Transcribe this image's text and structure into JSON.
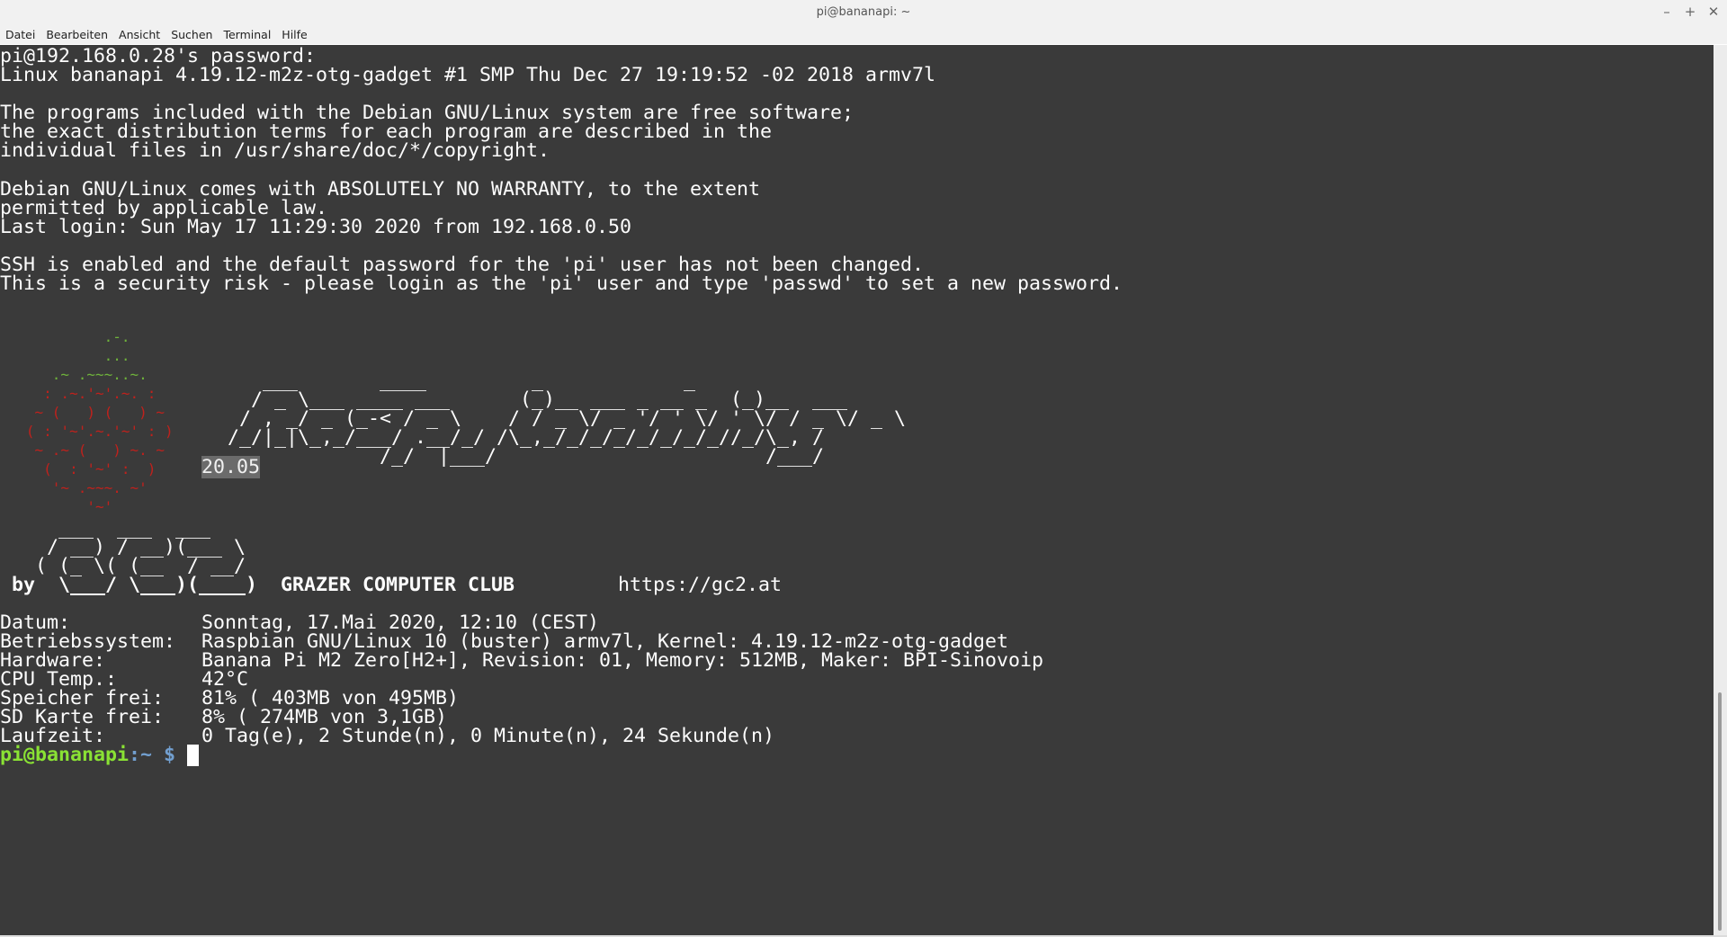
{
  "window": {
    "title": "pi@bananapi: ~",
    "controls": [
      "–",
      "+",
      "✕"
    ]
  },
  "menu": [
    "Datei",
    "Bearbeiten",
    "Ansicht",
    "Suchen",
    "Terminal",
    "Hilfe"
  ],
  "terminal": {
    "motd_lines": [
      "pi@192.168.0.28's password:",
      "Linux bananapi 4.19.12-m2z-otg-gadget #1 SMP Thu Dec 27 19:19:52 -02 2018 armv7l",
      "",
      "The programs included with the Debian GNU/Linux system are free software;",
      "the exact distribution terms for each program are described in the",
      "individual files in /usr/share/doc/*/copyright.",
      "",
      "Debian GNU/Linux comes with ABSOLUTELY NO WARRANTY, to the extent",
      "permitted by applicable law.",
      "Last login: Sun May 17 11:29:30 2020 from 192.168.0.50",
      "",
      "SSH is enabled and the default password for the 'pi' user has not been changed.",
      "This is a security risk - please login as the 'pi' user and type 'passwd' to set a new password."
    ],
    "rasp_leaves": [
      "            .-.",
      "            ...",
      "      .~ .~~~..~."
    ],
    "rasp_berry": [
      "     : .~.'~'.~. :",
      "    ~ (   ) (   ) ~",
      "   ( : '~'.~.'~' : )",
      "    ~ .~ (   ) ~. ~",
      "     (  : '~' :  )",
      "      '~ .~~~. ~'",
      "          '~'"
    ],
    "ascii_logo": [
      "      ___       ____         _            _",
      "     / _ \\___ ____ ___      (_)__ ___ _ __ _  (_)__  ___",
      "    / , _/ _ (_-< / _ \\    / / _ \\/ _ '/ ' \\/ ' \\/ / _ \\/ _ \\",
      "   /_/|_|\\_,_/___/ .__/_/ /\\_,_/_/_/_/_/_/_/_//_/\\_, /",
      "                /_/  |___/                       /___/"
    ],
    "version": "20.05",
    "gcc_logo": [
      "     ___  ___  ___",
      "    / __) / __)(___ \\",
      "   ( (_ \\( (__  / __/"
    ],
    "gcc_by": " by  \\___/ \\___)(____)",
    "club_name": "GRAZER COMPUTER CLUB",
    "club_url": "https://gc2.at",
    "sysinfo": [
      {
        "label": "Datum:",
        "value": "Sonntag, 17.Mai 2020, 12:10 (CEST)"
      },
      {
        "label": "Betriebssystem:",
        "value": "Raspbian GNU/Linux 10 (buster) armv7l, Kernel: 4.19.12-m2z-otg-gadget"
      },
      {
        "label": "Hardware:",
        "value": "Banana Pi M2 Zero[H2+], Revision: 01, Memory: 512MB, Maker: BPI-Sinovoip"
      },
      {
        "label": "CPU Temp.:",
        "value": "42°C"
      },
      {
        "label": "Speicher frei:",
        "value": "81% ( 403MB von 495MB)"
      },
      {
        "label": "SD Karte frei:",
        "value": "8% ( 274MB von 3,1GB)"
      },
      {
        "label": "Laufzeit:",
        "value": "0 Tag(e), 2 Stunde(n), 0 Minute(n), 24 Sekunde(n)"
      }
    ],
    "prompt": {
      "user_host": "pi@bananapi",
      "path": ":~",
      "symbol": " $ "
    }
  }
}
